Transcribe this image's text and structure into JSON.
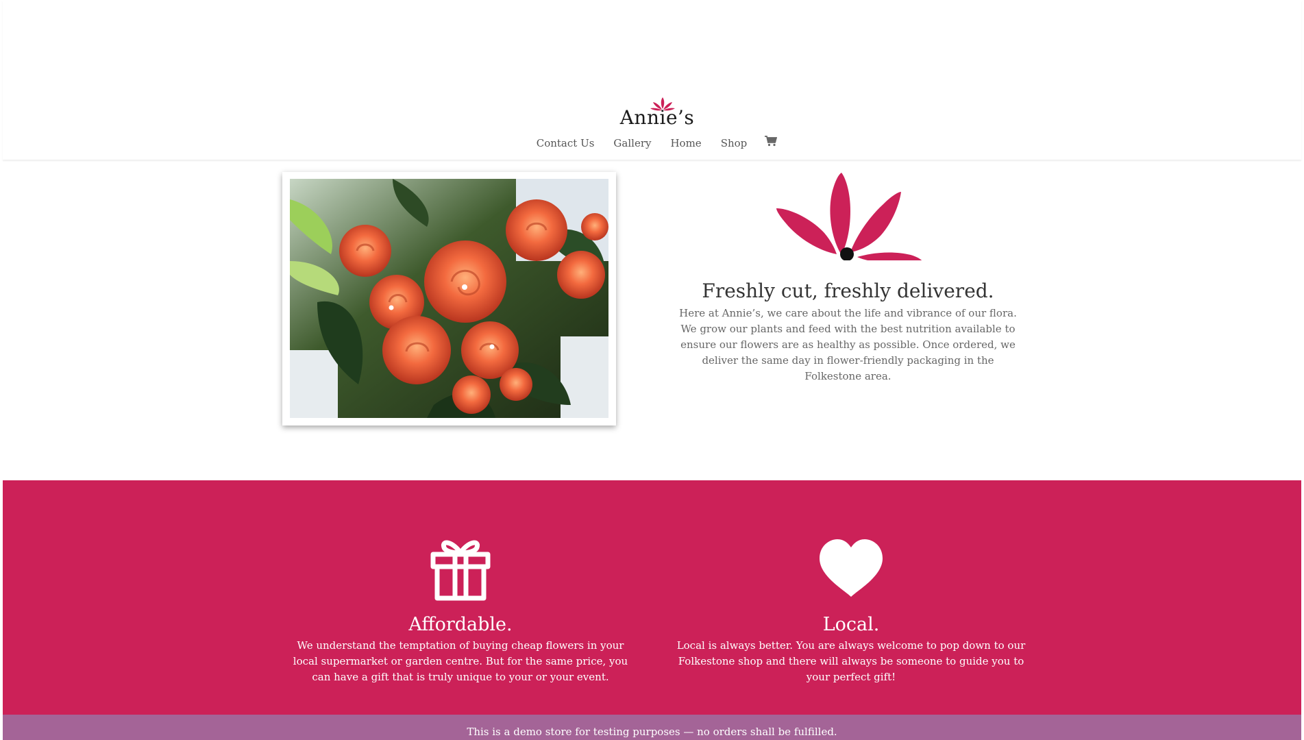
{
  "brand": {
    "logo_text": "Annie’s",
    "accent_color": "#cc2158",
    "notice_color": "#a46497"
  },
  "nav": {
    "items": [
      {
        "label": "Contact Us"
      },
      {
        "label": "Gallery"
      },
      {
        "label": "Home"
      },
      {
        "label": "Shop"
      }
    ],
    "cart_icon": "cart-icon"
  },
  "hero": {
    "image_alt": "",
    "mark_icon": "flower-petals-icon",
    "title": "Freshly cut, freshly delivered.",
    "text": "Here at Annie’s, we care about the life and vibrance of our flora. We grow our plants and feed with the best nutrition available to ensure our flowers are as healthy as possible. Once ordered, we deliver the same day in flower-friendly packaging in the Folkestone area."
  },
  "features": [
    {
      "icon": "gift-icon",
      "title": "Affordable.",
      "text": "We understand the temptation of buying cheap flowers in your local supermarket or garden centre. But for the same price, you can have a gift that is truly unique to your or your event."
    },
    {
      "icon": "heart-icon",
      "title": "Local.",
      "text": "Local is always better. You are always welcome to pop down to our Folkestone shop and there will always be someone to guide you to your perfect gift!"
    }
  ],
  "demo_notice": "This is a demo store for testing purposes — no orders shall be fulfilled."
}
